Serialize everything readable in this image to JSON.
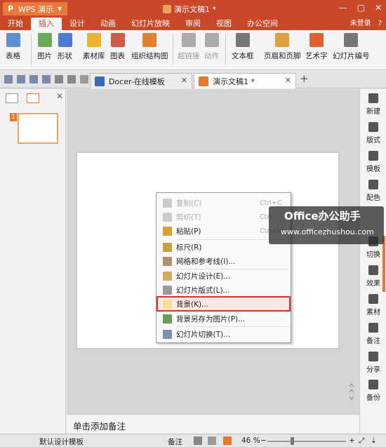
{
  "titlebar": {
    "app": "WPS 演示",
    "doc_title": "演示文稿1 *"
  },
  "menubar": {
    "items": [
      "开始",
      "插入",
      "设计",
      "动画",
      "幻灯片放映",
      "审阅",
      "视图",
      "办公空间"
    ],
    "active_index": 1,
    "login": "未登录",
    "help": "?"
  },
  "ribbon": {
    "items": [
      {
        "label": "表格",
        "color": "#5a8fd0",
        "disabled": false
      },
      {
        "label": "图片",
        "color": "#6aaa5a",
        "disabled": false
      },
      {
        "label": "形状",
        "color": "#4a7bd0",
        "disabled": false
      },
      {
        "label": "素材库",
        "color": "#f0b030",
        "disabled": false
      },
      {
        "label": "图表",
        "color": "#d05a4a",
        "disabled": false
      },
      {
        "label": "组织结构图",
        "color": "#e08030",
        "disabled": false
      },
      {
        "label": "超链接",
        "color": "#aaaaaa",
        "disabled": true
      },
      {
        "label": "动作",
        "color": "#aaaaaa",
        "disabled": true
      },
      {
        "label": "文本框",
        "color": "#777777",
        "disabled": false
      },
      {
        "label": "页眉和页脚",
        "color": "#e0a040",
        "disabled": false
      },
      {
        "label": "艺术字",
        "color": "#e06030",
        "disabled": false
      },
      {
        "label": "幻灯片编号",
        "color": "#777777",
        "disabled": false
      }
    ]
  },
  "tabs": [
    {
      "label": "Docer-在线模板",
      "color": "#3a6ab0"
    },
    {
      "label": "演示文稿1 *",
      "color": "#e8762c"
    }
  ],
  "slide_panel": {
    "slide_number": "1"
  },
  "context_menu": {
    "items": [
      {
        "label": "复制(C)",
        "shortcut": "Ctrl+C",
        "disabled": true,
        "icon": "copy-icon"
      },
      {
        "label": "剪切(T)",
        "shortcut": "Ctrl",
        "disabled": true,
        "icon": "cut-icon"
      },
      {
        "label": "粘贴(P)",
        "shortcut": "Ctrl+V",
        "disabled": false,
        "icon": "paste-icon"
      },
      {
        "label": "标尺(R)",
        "shortcut": "",
        "disabled": false,
        "icon": "ruler-icon"
      },
      {
        "label": "网格和参考线(I)...",
        "shortcut": "",
        "disabled": false,
        "icon": "grid-icon"
      },
      {
        "label": "幻灯片设计(E)...",
        "shortcut": "",
        "disabled": false,
        "icon": "slide-design-icon"
      },
      {
        "label": "幻灯片版式(L)...",
        "shortcut": "",
        "disabled": false,
        "icon": "slide-layout-icon"
      },
      {
        "label": "背景(K)...",
        "shortcut": "",
        "disabled": false,
        "highlighted": true,
        "icon": "background-icon"
      },
      {
        "label": "背景另存为图片(P)...",
        "shortcut": "",
        "disabled": false,
        "icon": "save-background-icon"
      },
      {
        "label": "幻灯片切换(T)...",
        "shortcut": "",
        "disabled": false,
        "icon": "slide-transition-icon"
      }
    ]
  },
  "watermark": {
    "brand": "Office办公助手",
    "url": "www.officezhushou.com"
  },
  "notes": {
    "placeholder": "单击添加备注"
  },
  "right_sidebar": {
    "items": [
      "新建",
      "版式",
      "模板",
      "配色",
      "切换",
      "效果",
      "素材",
      "备注",
      "分享",
      "备份"
    ]
  },
  "status": {
    "template": "默认设计模板",
    "notes": "备注",
    "zoom": "46 %"
  }
}
